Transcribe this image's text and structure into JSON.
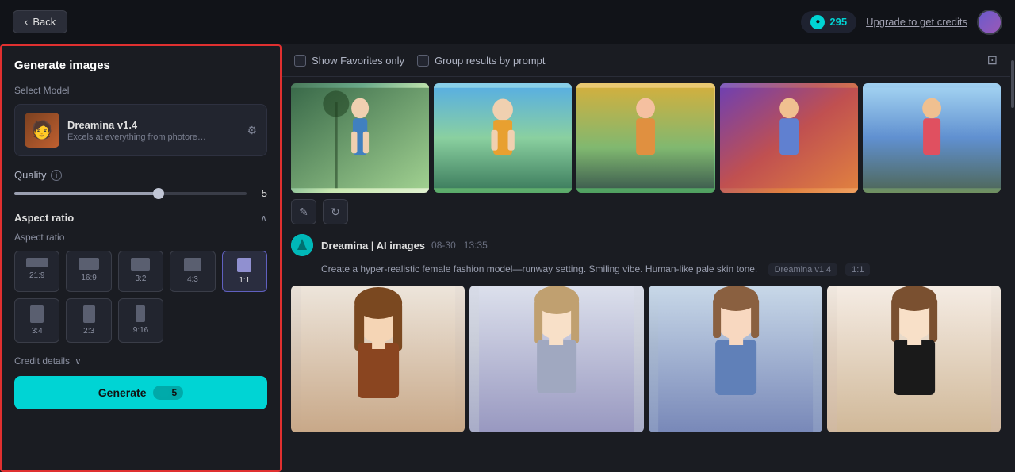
{
  "topbar": {
    "back_label": "Back",
    "credits_count": "295",
    "upgrade_label": "Upgrade to get credits"
  },
  "sidebar": {
    "title": "Generate images",
    "select_model_label": "Select Model",
    "model_name": "Dreamina v1.4",
    "model_desc": "Excels at everything from photoreali...",
    "quality_label": "Quality",
    "quality_value": "5",
    "aspect_ratio_label": "Aspect ratio",
    "aspect_ratio_sub_label": "Aspect ratio",
    "aspect_options": [
      {
        "label": "21:9",
        "shape_class": "shape-21-9",
        "active": false
      },
      {
        "label": "16:9",
        "shape_class": "shape-16-9",
        "active": false
      },
      {
        "label": "3:2",
        "shape_class": "shape-3-2",
        "active": false
      },
      {
        "label": "4:3",
        "shape_class": "shape-4-3",
        "active": false
      },
      {
        "label": "1:1",
        "shape_class": "shape-1-1",
        "active": true
      },
      {
        "label": "3:4",
        "shape_class": "shape-3-4",
        "active": false
      },
      {
        "label": "2:3",
        "shape_class": "shape-2-3",
        "active": false
      },
      {
        "label": "9:16",
        "shape_class": "shape-9-16",
        "active": false
      }
    ],
    "credit_details_label": "Credit details",
    "generate_label": "Generate",
    "generate_cost": "5"
  },
  "toolbar": {
    "show_favorites_label": "Show Favorites only",
    "group_results_label": "Group results by prompt"
  },
  "prompt1": {
    "author": "Dreamina | AI images",
    "date": "08-30",
    "time": "13:35",
    "text": "Create a hyper-realistic female fashion model—runway setting. Smiling vibe. Human-like pale skin tone.",
    "model_tag": "Dreamina v1.4",
    "ratio_tag": "1:1"
  },
  "icons": {
    "back_arrow": "‹",
    "chevron_up": "∧",
    "chevron_down": "∨",
    "edit": "✎",
    "refresh": "↻",
    "save": "⊡",
    "info": "i",
    "settings": "⚙",
    "credit": "●"
  }
}
